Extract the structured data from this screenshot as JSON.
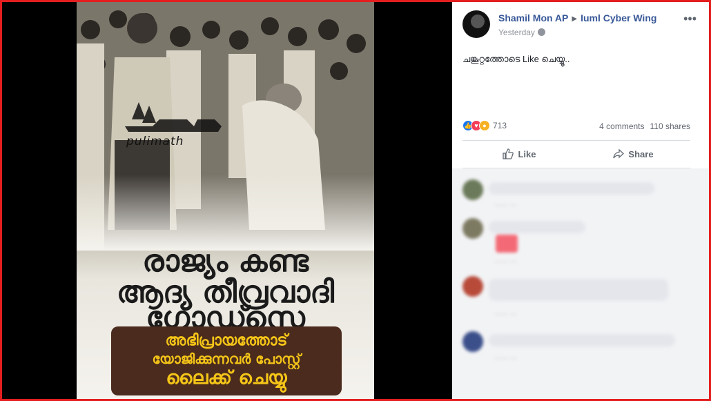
{
  "post": {
    "author": "Shamil Mon AP",
    "group": "Iuml Cyber Wing",
    "timestamp": "Yesterday",
    "privacy_icon": "globe-icon",
    "text": "ചങ്കൂറ്റത്തോടെ Like ചെയ്യൂ..",
    "reaction_icons": [
      "like-icon",
      "love-icon",
      "wow-icon"
    ],
    "reaction_count": "713",
    "comments_count": "4 comments",
    "shares_count": "110 shares",
    "actions": {
      "like": "Like",
      "share": "Share"
    }
  },
  "image": {
    "watermark": "pulimath",
    "headline_line1": "രാജ്യം കണ്ട",
    "headline_line2": "ആദ്യ തീവ്രവാദി",
    "headline_line3": "ഗോഡ്സെ",
    "cta_line1": "അഭിപ്രായത്തോട്",
    "cta_line2": "യോജിക്കുന്നവർ പോസ്റ്റ്",
    "cta_line3": "ലൈക്ക് ചെയ്യു"
  },
  "colors": {
    "frame": "#e41e1e",
    "link": "#385898",
    "cta_bg": "#4a2b1d",
    "cta_text": "#f5c518"
  }
}
